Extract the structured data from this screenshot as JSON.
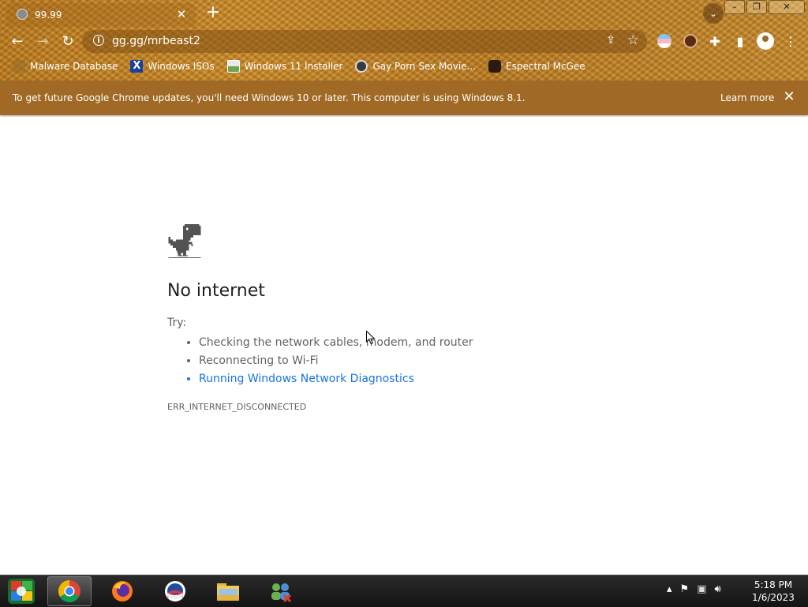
{
  "browser": {
    "tab_title": "99.99",
    "url": "gg.gg/mrbeast2",
    "bookmarks": [
      {
        "label": "Malware Database",
        "icon": "globe-icon"
      },
      {
        "label": "Windows ISOs",
        "icon": "x-icon"
      },
      {
        "label": "Windows 11 Installer",
        "icon": "image-icon"
      },
      {
        "label": "Gay Porn Sex Movie...",
        "icon": "face-icon"
      },
      {
        "label": "Espectral McGee",
        "icon": "mask-icon"
      }
    ],
    "infobar_message": "To get future Google Chrome updates, you'll need Windows 10 or later. This computer is using Windows 8.1.",
    "infobar_link": "Learn more"
  },
  "page": {
    "heading": "No internet",
    "try_label": "Try:",
    "suggestions": [
      "Checking the network cables, modem, and router",
      "Reconnecting to Wi-Fi",
      "Running Windows Network Diagnostics"
    ],
    "error_code": "ERR_INTERNET_DISCONNECTED"
  },
  "taskbar": {
    "time": "5:18 PM",
    "date": "1/6/2023"
  },
  "colors": {
    "infobar": "#a06a26",
    "link": "#1a73e8",
    "text_secondary": "#5f6368"
  }
}
